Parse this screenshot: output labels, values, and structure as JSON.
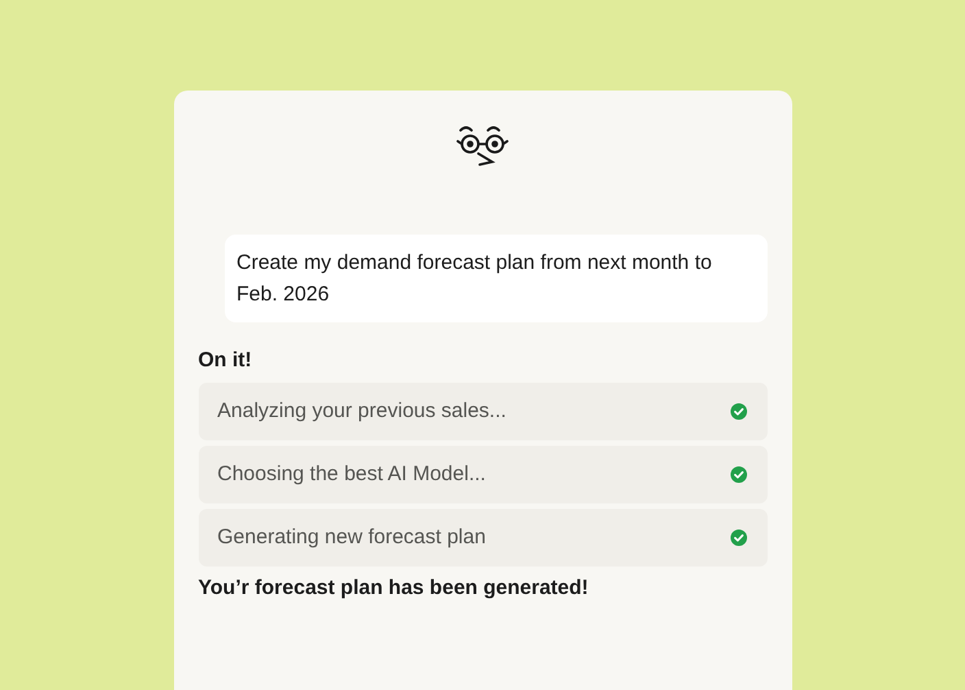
{
  "prompt": "Create my demand forecast plan from next month to Feb. 2026",
  "ack": "On it!",
  "steps": [
    {
      "label": "Analyzing your previous sales...",
      "done": true
    },
    {
      "label": "Choosing the best AI Model...",
      "done": true
    },
    {
      "label": "Generating new forecast plan",
      "done": true
    }
  ],
  "result": "You’r forecast plan has been generated!"
}
